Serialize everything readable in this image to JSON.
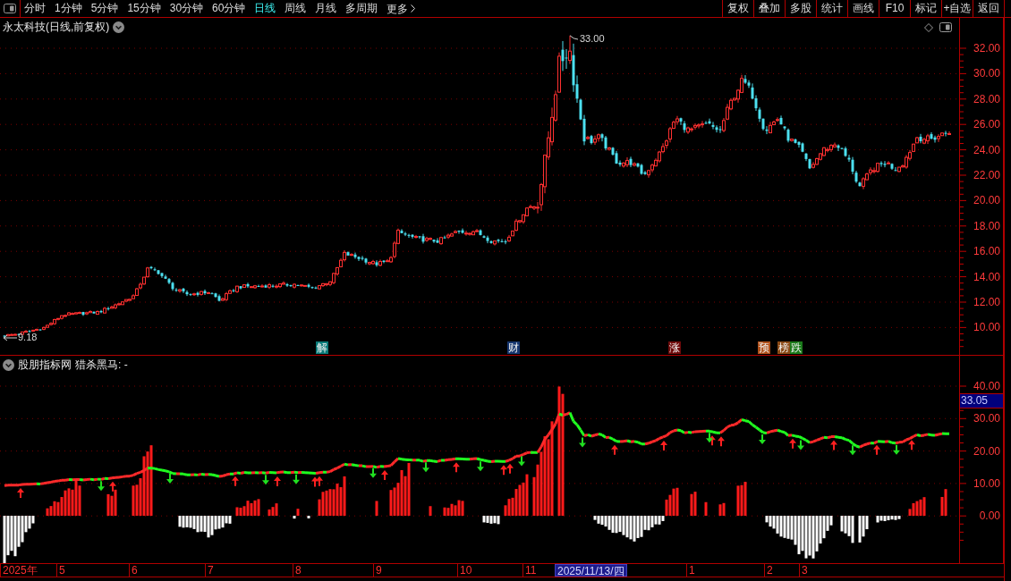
{
  "toolbar": {
    "periods": [
      {
        "label": "分时",
        "selected": false
      },
      {
        "label": "1分钟",
        "selected": false
      },
      {
        "label": "5分钟",
        "selected": false
      },
      {
        "label": "15分钟",
        "selected": false
      },
      {
        "label": "30分钟",
        "selected": false
      },
      {
        "label": "60分钟",
        "selected": false
      },
      {
        "label": "日线",
        "selected": true
      },
      {
        "label": "周线",
        "selected": false
      },
      {
        "label": "月线",
        "selected": false
      },
      {
        "label": "多周期",
        "selected": false
      }
    ],
    "more": "更多",
    "actions": [
      "复权",
      "叠加",
      "多股",
      "统计",
      "画线",
      "F10",
      "标记",
      "+自选",
      "返回"
    ]
  },
  "main_chart": {
    "title": "永太科技(日线,前复权)",
    "high_label": "33.00",
    "low_label": "9.18",
    "events": [
      {
        "label": "解",
        "color": "#0a7a78"
      },
      {
        "label": "财",
        "color": "#15356e"
      },
      {
        "label": "涨",
        "color": "#6e0a0a"
      },
      {
        "label": "预",
        "color": "#b0501a"
      },
      {
        "label": "榜",
        "color": "#8c4a16"
      },
      {
        "label": "跌",
        "color": "#1a7a1a"
      }
    ],
    "price_ticks": [
      "32.00",
      "30.00",
      "28.00",
      "26.00",
      "24.00",
      "22.00",
      "20.00",
      "18.00",
      "16.00",
      "14.00",
      "12.00",
      "10.00"
    ]
  },
  "indicator": {
    "source": "股朋指标网",
    "formula": "猎杀黑马: -",
    "ticks": [
      "40.00",
      "30.00",
      "20.00",
      "10.00",
      "0.00"
    ],
    "cursor_value": "33.05"
  },
  "date_axis": {
    "labels": [
      {
        "label": "2025年",
        "selected": false
      },
      {
        "label": "5",
        "selected": false
      },
      {
        "label": "6",
        "selected": false
      },
      {
        "label": "7",
        "selected": false
      },
      {
        "label": "8",
        "selected": false
      },
      {
        "label": "9",
        "selected": false
      },
      {
        "label": "10",
        "selected": false
      },
      {
        "label": "11",
        "selected": false
      },
      {
        "label": "2025/11/13/四",
        "selected": true
      },
      {
        "label": "1",
        "selected": false
      },
      {
        "label": "2",
        "selected": false
      },
      {
        "label": "3",
        "selected": false
      }
    ]
  }
}
